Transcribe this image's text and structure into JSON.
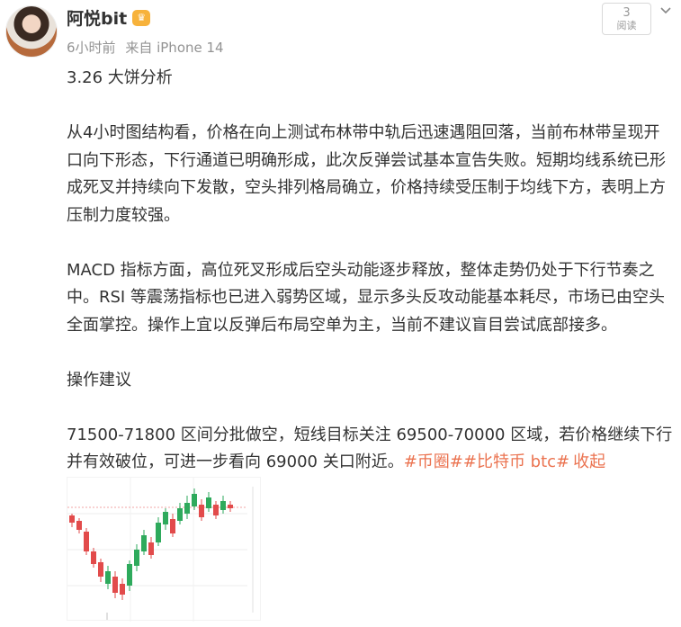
{
  "user": {
    "name": "阿悦bit",
    "badge_icon": "vip-crown-icon",
    "time": "6小时前",
    "source": "来自 iPhone 14"
  },
  "read": {
    "count": "3",
    "label": "阅读"
  },
  "post": {
    "title": "3.26 大饼分析",
    "p1": "从4小时图结构看，价格在向上测试布林带中轨后迅速遇阻回落，当前布林带呈现开口向下形态，下行通道已明确形成，此次反弹尝试基本宣告失败。短期均线系统已形成死叉并持续向下发散，空头排列格局确立，价格持续受压制于均线下方，表明上方压制力度较强。",
    "p2": "MACD 指标方面，高位死叉形成后空头动能逐步释放，整体走势仍处于下行节奏之中。RSI 等震荡指标也已进入弱势区域，显示多头反攻动能基本耗尽，市场已由空头全面掌控。操作上宜以反弹后布局空单为主，当前不建议盲目尝试底部接多。",
    "heading": "操作建议",
    "p3": "71500-71800 区间分批做空，短线目标关注 69500-70000 区域，若价格继续下行并有效破位，可进一步看向 69000 关口附近。",
    "tag1": "#币圈#",
    "tag2": "#比特币 btc#",
    "collapse": "收起"
  },
  "colors": {
    "link": "#eb7350",
    "candle_up": "#2eaa5c",
    "candle_down": "#e24b4b"
  }
}
